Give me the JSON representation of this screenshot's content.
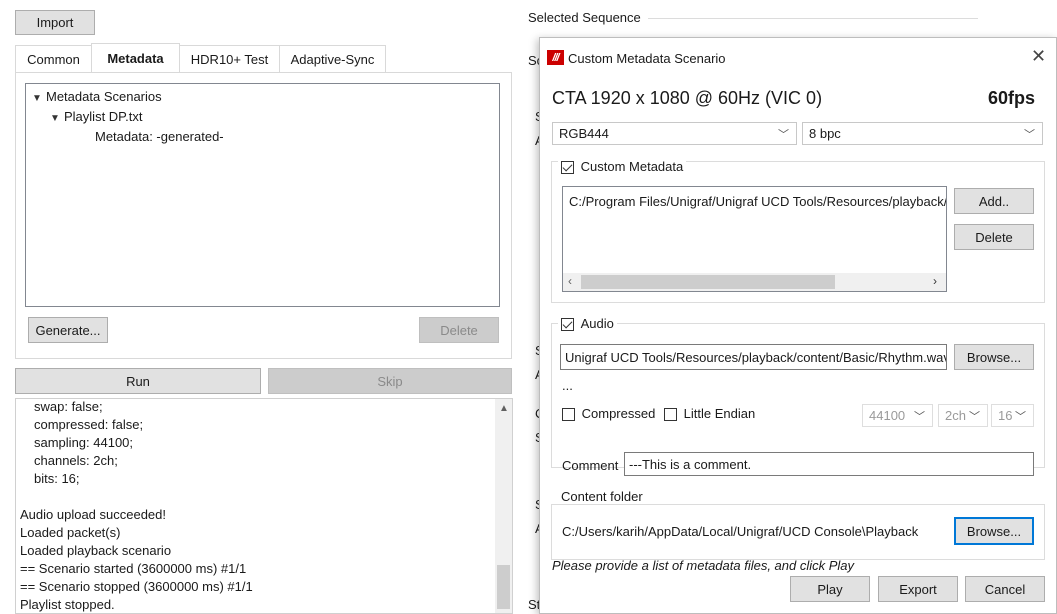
{
  "left": {
    "import_label": "Import",
    "tabs": [
      {
        "label": "Common"
      },
      {
        "label": "Metadata"
      },
      {
        "label": "HDR10+ Test"
      },
      {
        "label": "Adaptive-Sync"
      }
    ],
    "tree": {
      "root": "Metadata Scenarios",
      "child": "Playlist DP.txt",
      "leaf": "Metadata: -generated-"
    },
    "generate_label": "Generate...",
    "delete_label": "Delete",
    "run_label": "Run",
    "skip_label": "Skip",
    "log_lines": [
      "  swap: false;",
      "  compressed: false;",
      "  sampling: 44100;",
      "  channels: 2ch;",
      "  bits: 16;",
      "",
      "Audio upload succeeded!",
      "Loaded packet(s)",
      "Loaded playback scenario",
      "== Scenario started (3600000 ms) #1/1",
      "== Scenario stopped (3600000 ms) #1/1",
      "Playlist stopped."
    ]
  },
  "background_panel": {
    "selected_sequence_label": "Selected Sequence",
    "fragments": [
      "Sc",
      "S",
      "A",
      "S",
      "A",
      "C",
      "S",
      "S",
      "A",
      "St"
    ]
  },
  "dialog": {
    "title": "Custom Metadata Scenario",
    "video_mode": "CTA 1920 x 1080 @ 60Hz (VIC 0)",
    "fps": "60fps",
    "color_format": "RGB444",
    "bpc": "8 bpc",
    "custom_metadata_label": "Custom Metadata",
    "metadata_file": "C:/Program Files/Unigraf/Unigraf UCD Tools/Resources/playback/c",
    "add_label": "Add..",
    "delete_label": "Delete",
    "audio_label": "Audio",
    "audio_path": "Unigraf UCD Tools/Resources/playback/content/Basic/Rhythm.wav",
    "audio_browse_label": "Browse...",
    "ellipsis": "...",
    "compressed_label": "Compressed",
    "little_endian_label": "Little Endian",
    "sample_rate": "44100",
    "channels": "2ch",
    "bits": "16",
    "comment_label": "Comment",
    "comment_value": "---This is a comment.",
    "content_folder_label": "Content folder",
    "content_folder_path": "C:/Users/karih/AppData/Local/Unigraf/UCD Console\\Playback",
    "content_browse_label": "Browse...",
    "hint": "Please provide a list of metadata files, and click Play",
    "play_label": "Play",
    "export_label": "Export",
    "cancel_label": "Cancel",
    "accent_color": "#cc0000"
  }
}
